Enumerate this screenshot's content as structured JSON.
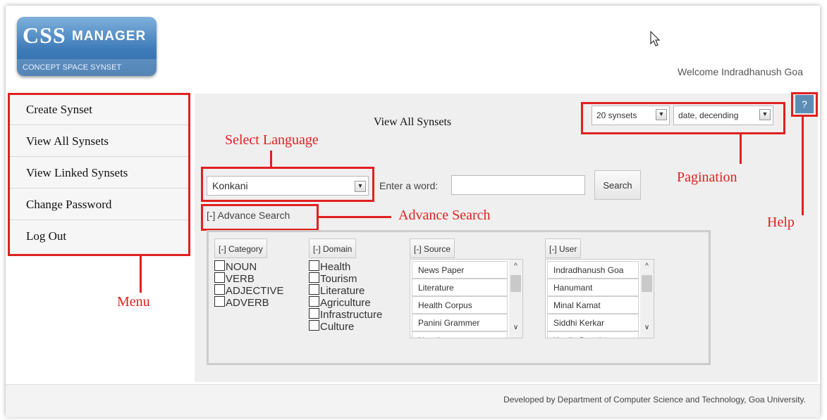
{
  "header": {
    "logo_main": "CSS",
    "logo_manager": "MANAGER",
    "logo_sub": "CONCEPT SPACE SYNSET",
    "welcome": "Welcome Indradhanush Goa"
  },
  "menu": {
    "items": [
      {
        "label": "Create Synset"
      },
      {
        "label": "View All Synsets"
      },
      {
        "label": "View Linked Synsets"
      },
      {
        "label": "Change Password"
      },
      {
        "label": "Log Out"
      }
    ]
  },
  "main": {
    "title": "View All Synsets",
    "pagination": {
      "per_page": "20 synsets",
      "sort": "date, decending"
    },
    "help_label": "?",
    "language": "Konkani",
    "word_label": "Enter a word:",
    "word_value": "",
    "search_label": "Search",
    "advance_toggle": "[-] Advance Search",
    "category": {
      "header": "[-] Category",
      "options": [
        "NOUN",
        "VERB",
        "ADJECTIVE",
        "ADVERB"
      ]
    },
    "domain": {
      "header": "[-] Domain",
      "options": [
        "Health",
        "Tourism",
        "Literature",
        "Agriculture",
        "Infrastructure",
        "Culture"
      ]
    },
    "source": {
      "header": "[-] Source",
      "items": [
        "News Paper",
        "Literature",
        "Health Corpus",
        "Panini Grammer",
        "Novel"
      ]
    },
    "user": {
      "header": "[-] User",
      "items": [
        "Indradhanush Goa",
        "Hanumant",
        "Minal Kamat",
        "Siddhi Kerkar",
        "Kapila Desai"
      ]
    }
  },
  "annotations": {
    "select_language": "Select Language",
    "pagination": "Pagination",
    "advance_search": "Advance Search",
    "help": "Help",
    "menu": "Menu"
  },
  "footer": {
    "text": "Developed by Department of Computer Science and Technology, Goa University."
  },
  "colors": {
    "annotation": "#e02020",
    "help_button": "#5d8db4",
    "logo": "#3d7bb8"
  }
}
